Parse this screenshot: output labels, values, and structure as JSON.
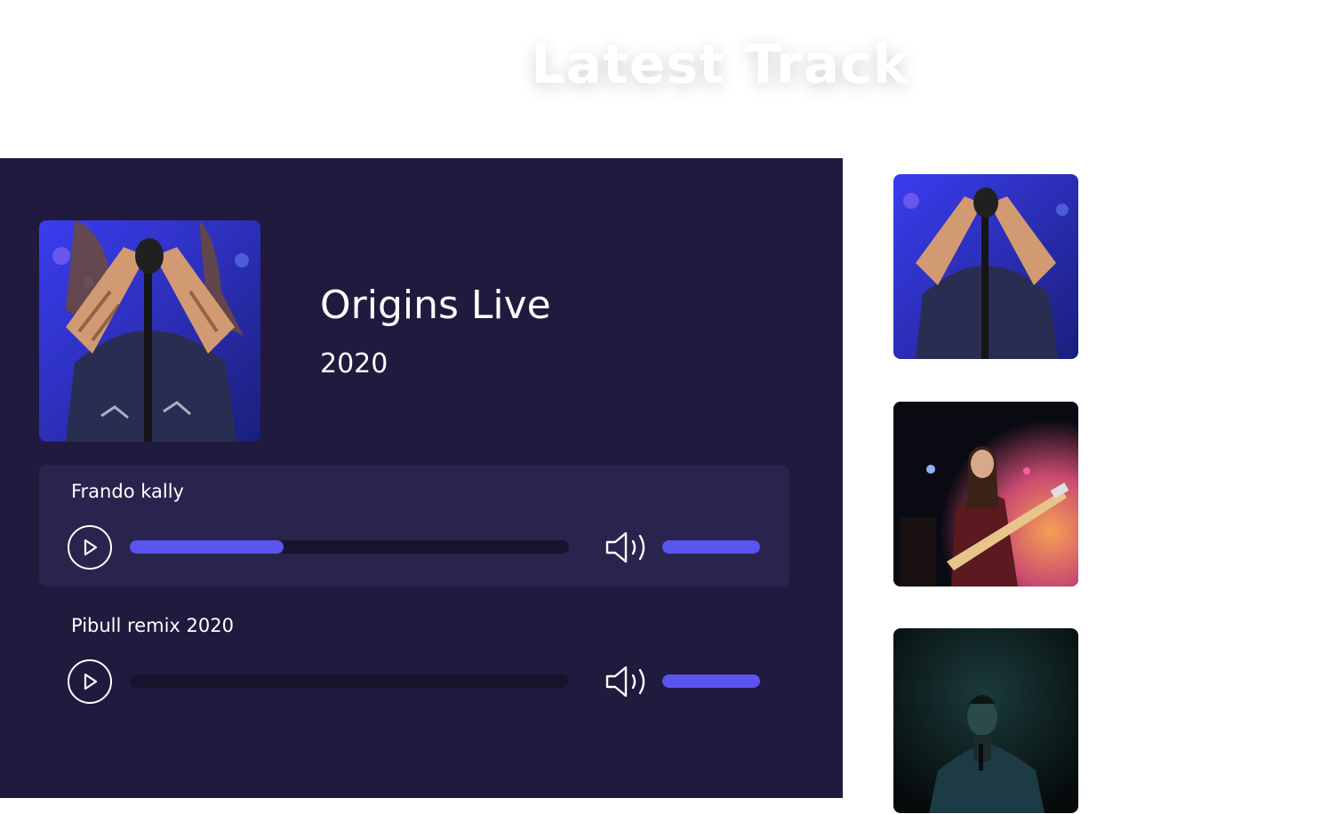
{
  "section": {
    "title": "Latest Track"
  },
  "album": {
    "title": "Origins Live",
    "year": "2020"
  },
  "tracks": [
    {
      "name": "Frando kally",
      "progress": 0.35,
      "volume": 1.0,
      "active": true
    },
    {
      "name": "Pibull remix 2020",
      "progress": 0.0,
      "volume": 1.0,
      "active": false
    }
  ],
  "playlist_thumbnails": [
    {
      "subject": "singer-with-microphone-stand"
    },
    {
      "subject": "guitarist-singer-on-stage"
    },
    {
      "subject": "singer-holding-microphone"
    }
  ],
  "colors": {
    "panel_bg": "#1f1a3e",
    "active_row_bg": "#29244d",
    "accent": "#5a54f0",
    "track_bg": "#17132d"
  },
  "icons": {
    "play": "play-icon",
    "volume": "volume-icon"
  }
}
